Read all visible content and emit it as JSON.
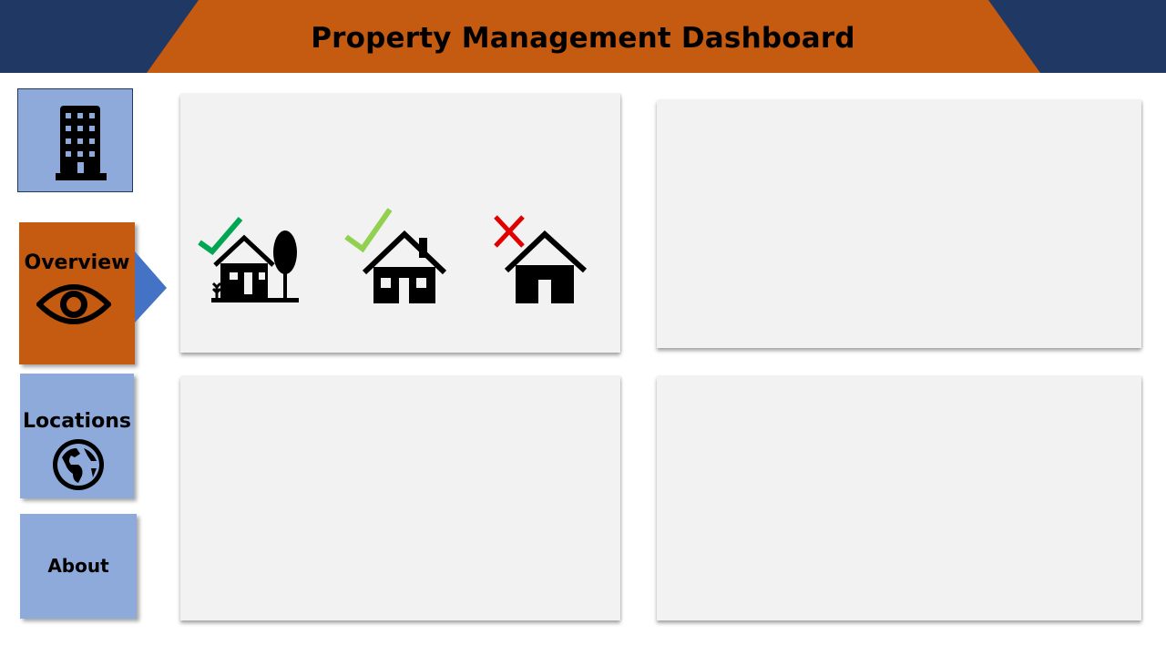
{
  "header": {
    "title": "Property Management Dashboard",
    "background_color": "#1f3864",
    "accent_color": "#c55a11"
  },
  "logo": {
    "icon": "office-building-icon"
  },
  "nav": {
    "overview": {
      "label": "Overview",
      "icon": "eye-icon",
      "color": "#c55a11",
      "active": true
    },
    "locations": {
      "label": "Locations",
      "icon": "globe-icon",
      "color": "#8eaadb"
    },
    "about": {
      "label": "About",
      "color": "#8eaadb"
    }
  },
  "overview_panel": {
    "items": [
      {
        "icon": "house-with-tree-icon",
        "status": "check",
        "status_color": "#00a651"
      },
      {
        "icon": "house-icon",
        "status": "check",
        "status_color": "#92d050"
      },
      {
        "icon": "house-icon",
        "status": "cross",
        "status_color": "#e00000"
      }
    ]
  }
}
